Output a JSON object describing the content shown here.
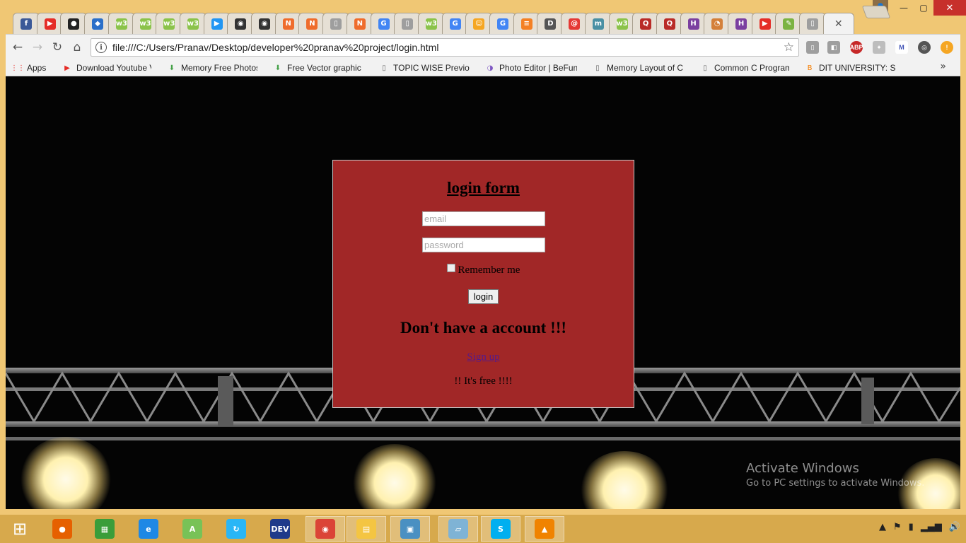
{
  "browser": {
    "tabs": [
      {
        "icon": "facebook-icon",
        "glyph": "f",
        "color": "#3b5998"
      },
      {
        "icon": "youtube-icon",
        "glyph": "▶",
        "color": "#e52d27"
      },
      {
        "icon": "github-icon",
        "glyph": "●",
        "color": "#222222"
      },
      {
        "icon": "feather-icon",
        "glyph": "◆",
        "color": "#2a6fc9"
      },
      {
        "icon": "w3schools-icon",
        "glyph": "w3",
        "color": "#8bc34a"
      },
      {
        "icon": "w3schools-icon",
        "glyph": "w3",
        "color": "#8bc34a"
      },
      {
        "icon": "w3schools-icon",
        "glyph": "w3",
        "color": "#8bc34a"
      },
      {
        "icon": "w3schools-icon",
        "glyph": "w3",
        "color": "#8bc34a"
      },
      {
        "icon": "play-circle-icon",
        "glyph": "▶",
        "color": "#2196f3"
      },
      {
        "icon": "mascot-icon",
        "glyph": "◉",
        "color": "#333333"
      },
      {
        "icon": "mascot-icon",
        "glyph": "◉",
        "color": "#333333"
      },
      {
        "icon": "n-logo-icon",
        "glyph": "N",
        "color": "#ef6c2c"
      },
      {
        "icon": "n-logo-icon",
        "glyph": "N",
        "color": "#ef6c2c"
      },
      {
        "icon": "page-icon",
        "glyph": "▯",
        "color": "#9e9e9e"
      },
      {
        "icon": "n-logo-icon",
        "glyph": "N",
        "color": "#ef6c2c"
      },
      {
        "icon": "google-icon",
        "glyph": "G",
        "color": "#4285f4"
      },
      {
        "icon": "page-icon",
        "glyph": "▯",
        "color": "#9e9e9e"
      },
      {
        "icon": "w3schools-icon",
        "glyph": "w3",
        "color": "#8bc34a"
      },
      {
        "icon": "google-icon",
        "glyph": "G",
        "color": "#4285f4"
      },
      {
        "icon": "smiley-icon",
        "glyph": "☺",
        "color": "#f5a623"
      },
      {
        "icon": "google-icon",
        "glyph": "G",
        "color": "#4285f4"
      },
      {
        "icon": "stackoverflow-icon",
        "glyph": "≡",
        "color": "#f48024"
      },
      {
        "icon": "dit-icon",
        "glyph": "D",
        "color": "#555555"
      },
      {
        "icon": "swirl-icon",
        "glyph": "@",
        "color": "#e53935"
      },
      {
        "icon": "m-logo-icon",
        "glyph": "m",
        "color": "#4a90a4"
      },
      {
        "icon": "w3schools-icon",
        "glyph": "w3",
        "color": "#8bc34a"
      },
      {
        "icon": "quora-icon",
        "glyph": "Q",
        "color": "#b92b27"
      },
      {
        "icon": "quora-icon",
        "glyph": "Q",
        "color": "#b92b27"
      },
      {
        "icon": "hackerrank-icon",
        "glyph": "H",
        "color": "#7b3fa0"
      },
      {
        "icon": "owl-icon",
        "glyph": "◔",
        "color": "#d4803a"
      },
      {
        "icon": "hackerrank-icon",
        "glyph": "H",
        "color": "#7b3fa0"
      },
      {
        "icon": "youtube-icon",
        "glyph": "▶",
        "color": "#e52d27"
      },
      {
        "icon": "android-icon",
        "glyph": "✎",
        "color": "#7cb342"
      },
      {
        "icon": "page-icon",
        "glyph": "▯",
        "color": "#9e9e9e"
      }
    ],
    "active_tab_close": "✕",
    "url": "file:///C:/Users/Pranav/Desktop/developer%20pranav%20project/login.html",
    "bookmarks": [
      {
        "label": "Apps",
        "icon": "apps-grid-icon",
        "glyph": "⋮⋮",
        "color": "#e53935",
        "width": 60
      },
      {
        "label": "Download Youtube Vi",
        "icon": "youtube-icon",
        "glyph": "▶",
        "color": "#e52d27",
        "width": 138
      },
      {
        "label": "Memory Free Photos",
        "icon": "download-arrow-icon",
        "glyph": "⬇",
        "color": "#43a047",
        "width": 140
      },
      {
        "label": "Free Vector graphic a",
        "icon": "download-arrow-icon",
        "glyph": "⬇",
        "color": "#43a047",
        "width": 140
      },
      {
        "label": "TOPIC WISE Previous",
        "icon": "page-icon",
        "glyph": "▯",
        "color": "#666666",
        "width": 140
      },
      {
        "label": "Photo Editor | BeFunk",
        "icon": "befunky-icon",
        "glyph": "◑",
        "color": "#7e57c2",
        "width": 142
      },
      {
        "label": "Memory Layout of C P",
        "icon": "page-icon",
        "glyph": "▯",
        "color": "#666666",
        "width": 142
      },
      {
        "label": "Common C Programm",
        "icon": "page-icon",
        "glyph": "▯",
        "color": "#666666",
        "width": 138
      },
      {
        "label": "DIT UNIVERSITY: Sept",
        "icon": "blogger-icon",
        "glyph": "B",
        "color": "#f57d00",
        "width": 140
      }
    ],
    "bookmarks_more": "»"
  },
  "login": {
    "title": "login form",
    "email_placeholder": "email",
    "password_placeholder": "password",
    "remember_label": "Remember me",
    "login_button": "login",
    "no_account": "Don't have a account !!!",
    "signup_link": "Sign up",
    "free_text": "!! It's free !!!!"
  },
  "watermark": {
    "title": "Activate Windows",
    "subtitle": "Go to PC settings to activate Windows."
  },
  "taskbar": {
    "items": [
      {
        "icon": "windows-start-icon",
        "glyph": "⊞",
        "color": "#ffffff"
      },
      {
        "icon": "firefox-icon",
        "glyph": "●",
        "color": "#e66000"
      },
      {
        "icon": "windows-store-icon",
        "glyph": "▦",
        "color": "#3a9d3a"
      },
      {
        "icon": "internet-explorer-icon",
        "glyph": "e",
        "color": "#1e88e5"
      },
      {
        "icon": "android-studio-icon",
        "glyph": "A",
        "color": "#78c257"
      },
      {
        "icon": "sync-app-icon",
        "glyph": "↻",
        "color": "#29b6f6"
      },
      {
        "icon": "devcpp-icon",
        "glyph": "DEV",
        "color": "#1e3a8a"
      },
      {
        "icon": "chrome-icon",
        "glyph": "◉",
        "color": "#db4437"
      },
      {
        "icon": "file-explorer-icon",
        "glyph": "▤",
        "color": "#f4c542"
      },
      {
        "icon": "photos-app-icon",
        "glyph": "▣",
        "color": "#4a90c2"
      },
      {
        "icon": "notepad-icon",
        "glyph": "▱",
        "color": "#7fb3d5"
      },
      {
        "icon": "skype-icon",
        "glyph": "S",
        "color": "#00aff0"
      },
      {
        "icon": "vlc-icon",
        "glyph": "▲",
        "color": "#f08300"
      }
    ],
    "tray": [
      "▲",
      "⚑",
      "▮",
      "▂▄▆",
      "🔊"
    ]
  }
}
